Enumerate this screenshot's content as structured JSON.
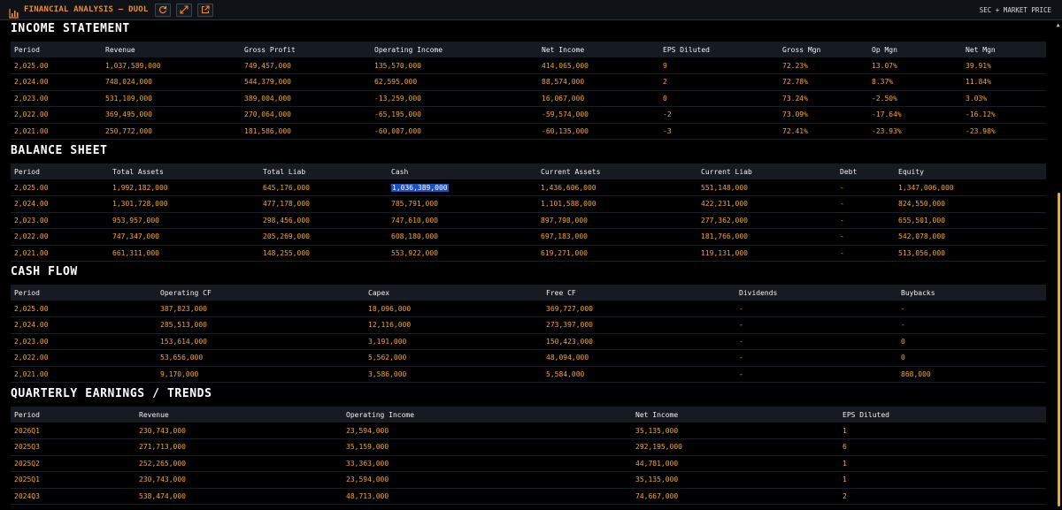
{
  "header": {
    "title": "FINANCIAL ANALYSIS — DUOL",
    "source_label": "SEC + MARKET PRICE"
  },
  "sections": {
    "income": {
      "title": "INCOME STATEMENT",
      "columns": [
        "Period",
        "Revenue",
        "Gross Profit",
        "Operating Income",
        "Net Income",
        "EPS Diluted",
        "Gross Mgn",
        "Op Mgn",
        "Net Mgn"
      ],
      "rows": [
        [
          "2,025.00",
          "1,037,589,000",
          "749,457,000",
          "135,570,000",
          "414,065,000",
          "9",
          "72.23%",
          "13.07%",
          "39.91%"
        ],
        [
          "2,024.00",
          "748,024,000",
          "544,379,000",
          "62,595,000",
          "88,574,000",
          "2",
          "72.78%",
          "8.37%",
          "11.84%"
        ],
        [
          "2,023.00",
          "531,109,000",
          "389,004,000",
          "-13,259,000",
          "16,067,000",
          "0",
          "73.24%",
          "-2.50%",
          "3.03%"
        ],
        [
          "2,022.00",
          "369,495,000",
          "270,064,000",
          "-65,195,000",
          "-59,574,000",
          "-2",
          "73.09%",
          "-17.64%",
          "-16.12%"
        ],
        [
          "2,021.00",
          "250,772,000",
          "181,586,000",
          "-60,007,000",
          "-60,135,000",
          "-3",
          "72.41%",
          "-23.93%",
          "-23.98%"
        ]
      ]
    },
    "balance": {
      "title": "BALANCE SHEET",
      "columns": [
        "Period",
        "Total Assets",
        "Total Liab",
        "Cash",
        "Current Assets",
        "Current Liab",
        "Debt",
        "Equity"
      ],
      "rows": [
        [
          "2,025.00",
          "1,992,182,000",
          "645,176,000",
          "1,036,389,000",
          "1,436,606,000",
          "551,148,000",
          "-",
          "1,347,006,000"
        ],
        [
          "2,024.00",
          "1,301,728,000",
          "477,178,000",
          "785,791,000",
          "1,101,588,000",
          "422,231,000",
          "-",
          "824,550,000"
        ],
        [
          "2,023.00",
          "953,957,000",
          "298,456,000",
          "747,610,000",
          "897,798,000",
          "277,362,000",
          "-",
          "655,501,000"
        ],
        [
          "2,022.00",
          "747,347,000",
          "205,269,000",
          "608,180,000",
          "697,183,000",
          "181,766,000",
          "-",
          "542,078,000"
        ],
        [
          "2,021.00",
          "661,311,000",
          "148,255,000",
          "553,922,000",
          "619,271,000",
          "119,131,000",
          "-",
          "513,056,000"
        ]
      ]
    },
    "cashflow": {
      "title": "CASH FLOW",
      "columns": [
        "Period",
        "Operating CF",
        "Capex",
        "Free CF",
        "Dividends",
        "Buybacks"
      ],
      "rows": [
        [
          "2,025.00",
          "387,823,000",
          "18,096,000",
          "369,727,000",
          "-",
          "-"
        ],
        [
          "2,024.00",
          "285,513,000",
          "12,116,000",
          "273,397,000",
          "-",
          "-"
        ],
        [
          "2,023.00",
          "153,614,000",
          "3,191,000",
          "150,423,000",
          "-",
          "0"
        ],
        [
          "2,022.00",
          "53,656,000",
          "5,562,000",
          "48,094,000",
          "-",
          "0"
        ],
        [
          "2,021.00",
          "9,170,000",
          "3,586,000",
          "5,584,000",
          "-",
          "868,000"
        ]
      ]
    },
    "quarterly": {
      "title": "QUARTERLY EARNINGS / TRENDS",
      "columns": [
        "Period",
        "Revenue",
        "Operating Income",
        "Net Income",
        "EPS Diluted"
      ],
      "rows": [
        [
          "2026Q1",
          "230,743,000",
          "23,594,000",
          "35,135,000",
          "1"
        ],
        [
          "2025Q3",
          "271,713,000",
          "35,159,000",
          "292,195,000",
          "6"
        ],
        [
          "2025Q2",
          "252,265,000",
          "33,363,000",
          "44,781,000",
          "1"
        ],
        [
          "2025Q1",
          "230,743,000",
          "23,594,000",
          "35,135,000",
          "1"
        ],
        [
          "2024Q3",
          "538,474,000",
          "48,713,000",
          "74,667,000",
          "2"
        ]
      ]
    }
  },
  "colors": {
    "accent": "#f28c28",
    "value": "#f5a623",
    "header_bg": "#161b22",
    "selection": "#1f4fbf"
  },
  "icons": {
    "title": "bar-chart-icon",
    "refresh": "refresh-icon",
    "expand": "expand-icon",
    "popout": "external-link-icon"
  }
}
